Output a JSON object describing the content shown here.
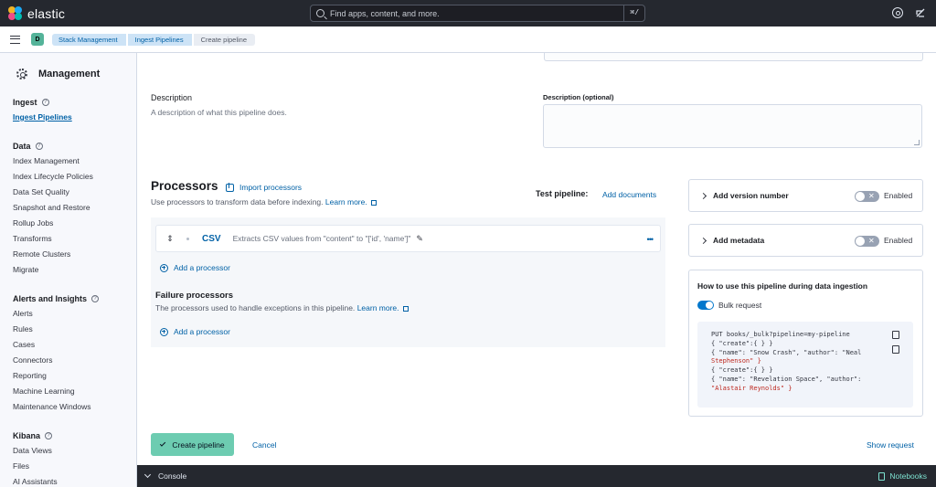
{
  "header": {
    "brand": "elastic",
    "search_placeholder": "Find apps, content, and more.",
    "search_shortcut": "⌘/"
  },
  "subbar": {
    "space_initial": "D",
    "breadcrumbs": [
      "Stack Management",
      "Ingest Pipelines",
      "Create pipeline"
    ]
  },
  "sidebar": {
    "title": "Management",
    "groups": [
      {
        "title": "Ingest",
        "items": [
          "Ingest Pipelines"
        ]
      },
      {
        "title": "Data",
        "items": [
          "Index Management",
          "Index Lifecycle Policies",
          "Data Set Quality",
          "Snapshot and Restore",
          "Rollup Jobs",
          "Transforms",
          "Remote Clusters",
          "Migrate"
        ]
      },
      {
        "title": "Alerts and Insights",
        "items": [
          "Alerts",
          "Rules",
          "Cases",
          "Connectors",
          "Reporting",
          "Machine Learning",
          "Maintenance Windows"
        ]
      },
      {
        "title": "Kibana",
        "items": [
          "Data Views",
          "Files",
          "AI Assistants"
        ]
      }
    ]
  },
  "description": {
    "title": "Description",
    "help": "A description of what this pipeline does.",
    "field_label": "Description (optional)"
  },
  "processors": {
    "title": "Processors",
    "import_label": "Import processors",
    "subtitle": "Use processors to transform data before indexing.",
    "learn_more": "Learn more.",
    "test_label": "Test pipeline:",
    "add_documents": "Add documents",
    "items": [
      {
        "name": "CSV",
        "description": "Extracts CSV values from \"content\" to \"['id', 'name']\""
      }
    ],
    "add_processor": "Add a processor",
    "failure_title": "Failure processors",
    "failure_subtitle": "The processors used to handle exceptions in this pipeline.",
    "failure_learn_more": "Learn more.",
    "failure_add_processor": "Add a processor"
  },
  "options": {
    "version": {
      "label": "Add version number",
      "toggle_label": "Enabled",
      "enabled": false
    },
    "metadata": {
      "label": "Add metadata",
      "toggle_label": "Enabled",
      "enabled": false
    }
  },
  "howto": {
    "title": "How to use this pipeline during data ingestion",
    "bulk_label": "Bulk request",
    "bulk_enabled": true,
    "code_lines": [
      "PUT books/_bulk?pipeline=my-pipeline",
      "{ \"create\":{ } }",
      "{ \"name\": \"Snow Crash\", \"author\": \"Neal",
      "Stephenson\" }",
      "{ \"create\":{ } }",
      "{ \"name\": \"Revelation Space\", \"author\":",
      "\"Alastair Reynolds\" }"
    ]
  },
  "footer": {
    "create_label": "Create pipeline",
    "cancel_label": "Cancel",
    "show_request_label": "Show request"
  },
  "console": {
    "label": "Console",
    "notebooks_label": "Notebooks"
  },
  "colors": {
    "header_bg": "#25282f",
    "link": "#0061a6",
    "primary_button": "#6dccb1",
    "toggle_on": "#0077cc"
  }
}
